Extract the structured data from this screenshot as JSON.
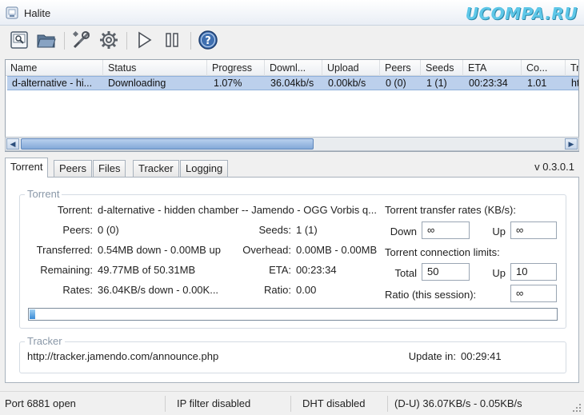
{
  "window": {
    "title": "Halite",
    "watermark": "UCOMPA.RU"
  },
  "toolbar": {
    "icons": [
      "open-torrent-icon",
      "open-folder-icon",
      "tools-icon",
      "settings-gear-icon",
      "resume-play-icon",
      "pause-icon",
      "help-icon"
    ]
  },
  "torrent_list": {
    "columns": [
      "Name",
      "Status",
      "Progress",
      "Downl...",
      "Upload",
      "Peers",
      "Seeds",
      "ETA",
      "Co...",
      "Tr"
    ],
    "rows": [
      [
        "d-alternative - hi...",
        "Downloading",
        "1.07%",
        "36.04kb/s",
        "0.00kb/s",
        "0 (0)",
        "1 (1)",
        "00:23:34",
        "1.01",
        "ht"
      ]
    ]
  },
  "tabs": [
    "Torrent",
    "Peers",
    "Files",
    "Tracker",
    "Logging"
  ],
  "version": "v 0.3.0.1",
  "torrent_group": {
    "title": "Torrent",
    "torrent_label": "Torrent:",
    "torrent_value": "d-alternative - hidden chamber -- Jamendo - OGG Vorbis q...",
    "peers_label": "Peers:",
    "peers_value": "0 (0)",
    "seeds_label": "Seeds:",
    "seeds_value": "1 (1)",
    "transferred_label": "Transferred:",
    "transferred_value": "0.54MB down - 0.00MB up",
    "overhead_label": "Overhead:",
    "overhead_value": "0.00MB - 0.00MB",
    "remaining_label": "Remaining:",
    "remaining_value": "49.77MB of 50.31MB",
    "eta_label": "ETA:",
    "eta_value": "00:23:34",
    "rates_label": "Rates:",
    "rates_value": "36.04KB/s down - 0.00K...",
    "ratio_label": "Ratio:",
    "ratio_value": "0.00",
    "transfer_rates_title": "Torrent transfer rates (KB/s):",
    "down_label": "Down",
    "down_value": "∞",
    "up_label": "Up",
    "up_value": "∞",
    "limits_title": "Torrent connection limits:",
    "total_label": "Total",
    "total_value": "50",
    "up_limit_label": "Up",
    "up_limit_value": "10",
    "ratio_session_label": "Ratio (this session):",
    "ratio_session_value": "∞",
    "progress_fraction": 0.0107
  },
  "tracker_group": {
    "title": "Tracker",
    "url": "http://tracker.jamendo.com/announce.php",
    "update_label": "Update in:",
    "update_value": "00:29:41"
  },
  "statusbar": {
    "port": "Port 6881 open",
    "ipfilter": "IP filter disabled",
    "dht": "DHT disabled",
    "rates": "(D-U) 36.07KB/s - 0.05KB/s"
  }
}
